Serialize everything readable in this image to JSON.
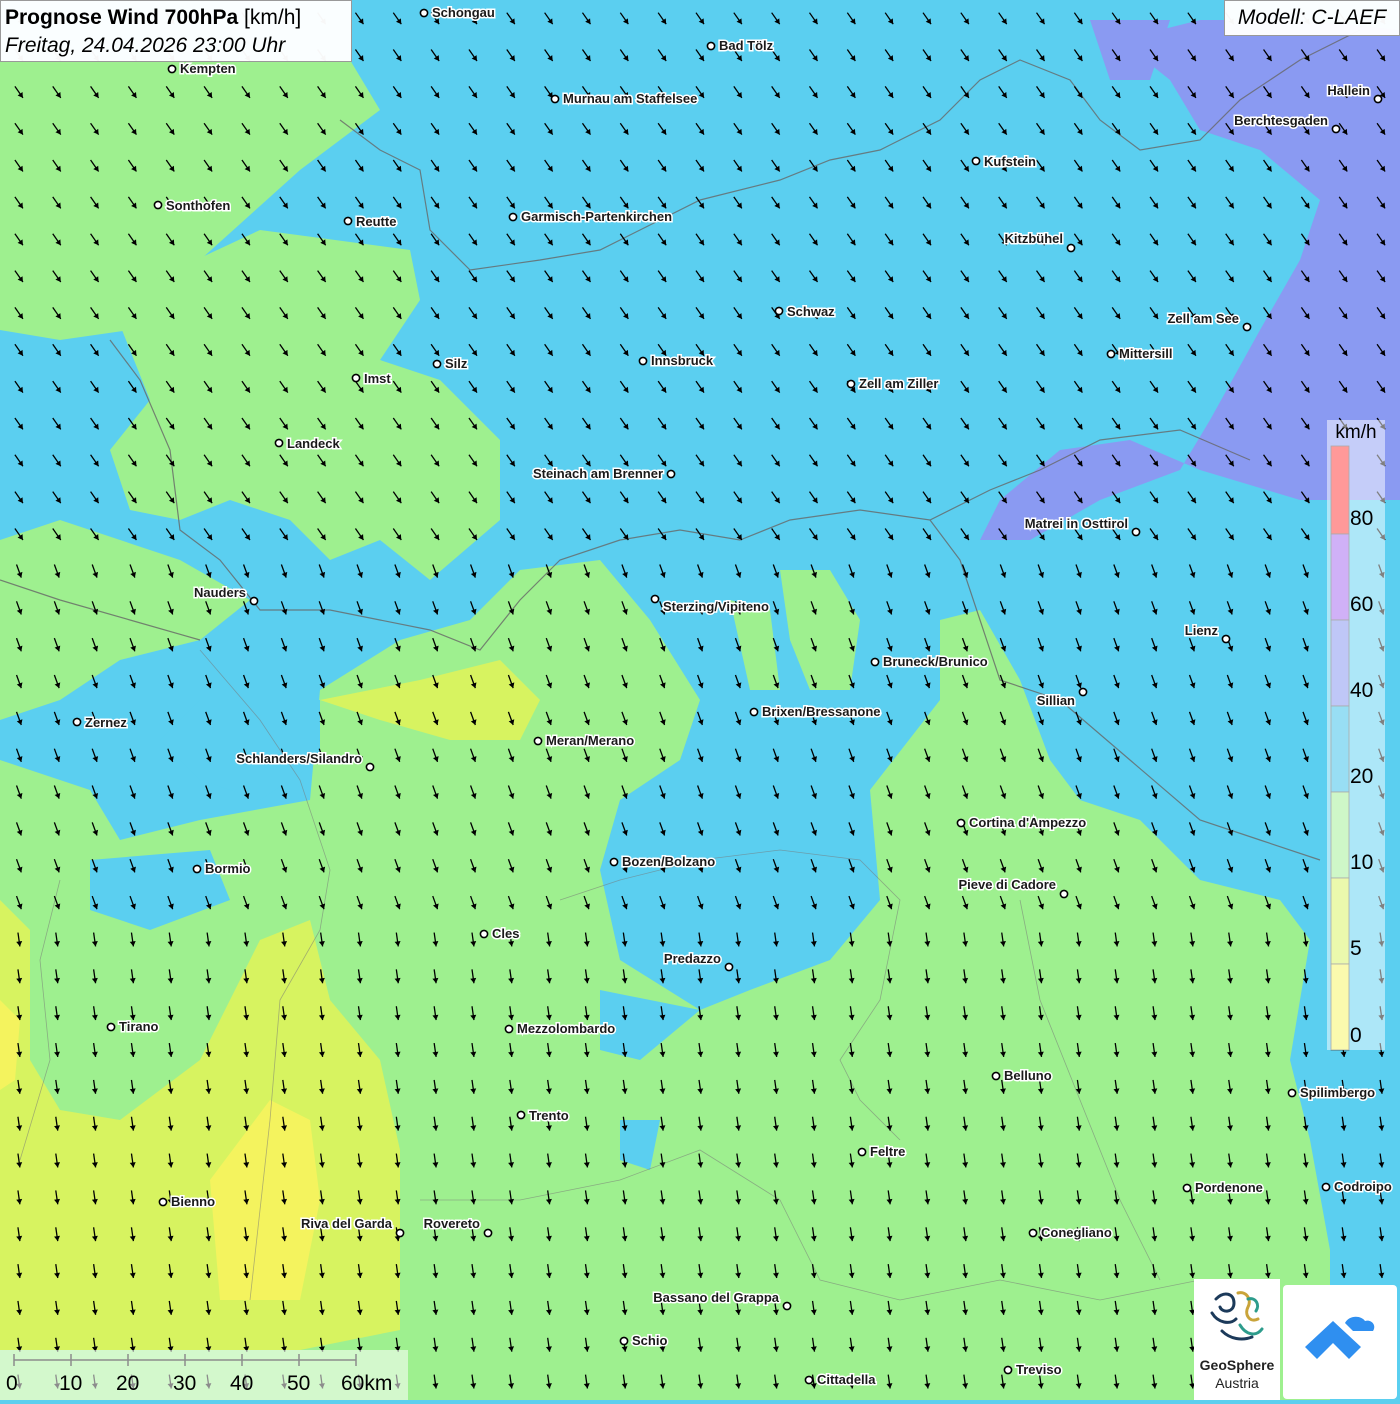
{
  "header": {
    "title_bold": "Prognose Wind 700hPa",
    "title_unit": "[km/h]",
    "subtitle": "Freitag, 24.04.2026 23:00 Uhr",
    "model": "Modell: C-LAEF"
  },
  "legend": {
    "unit": "km/h",
    "ticks": [
      "80",
      "60",
      "40",
      "20",
      "10",
      "5",
      "0"
    ],
    "colors": {
      "above_80": "#ff3333",
      "60_80": "#a062ee",
      "40_60": "#7f8fef",
      "20_40": "#5bc6ee",
      "10_20": "#2bbce8",
      "5_10": "#9cef90",
      "0_5": "#d6f25a",
      "zero": "#f6f55c"
    }
  },
  "scale": {
    "labels": [
      "0",
      "10",
      "20",
      "30",
      "40",
      "50",
      "60km"
    ]
  },
  "cities": [
    {
      "name": "Schongau"
    },
    {
      "name": "Bad Tölz"
    },
    {
      "name": "Kempten"
    },
    {
      "name": "Murnau am Staffelsee"
    },
    {
      "name": "Hallein"
    },
    {
      "name": "Berchtesgaden"
    },
    {
      "name": "Kufstein"
    },
    {
      "name": "Sonthofen"
    },
    {
      "name": "Reutte"
    },
    {
      "name": "Garmisch-Partenkirchen"
    },
    {
      "name": "Kitzbühel"
    },
    {
      "name": "Schwaz"
    },
    {
      "name": "Zell am See"
    },
    {
      "name": "Mittersill"
    },
    {
      "name": "Innsbruck"
    },
    {
      "name": "Silz"
    },
    {
      "name": "Imst"
    },
    {
      "name": "Zell am Ziller"
    },
    {
      "name": "Landeck"
    },
    {
      "name": "Steinach am Brenner"
    },
    {
      "name": "Matrei in Osttirol"
    },
    {
      "name": "Nauders"
    },
    {
      "name": "Sterzing/Vipiteno"
    },
    {
      "name": "Lienz"
    },
    {
      "name": "Bruneck/Brunico"
    },
    {
      "name": "Sillian"
    },
    {
      "name": "Brixen/Bressanone"
    },
    {
      "name": "Zernez"
    },
    {
      "name": "Meran/Merano"
    },
    {
      "name": "Schlanders/Silandro"
    },
    {
      "name": "Cortina d'Ampezzo"
    },
    {
      "name": "Bozen/Bolzano"
    },
    {
      "name": "Bormio"
    },
    {
      "name": "Pieve di Cadore"
    },
    {
      "name": "Cles"
    },
    {
      "name": "Predazzo"
    },
    {
      "name": "Tirano"
    },
    {
      "name": "Mezzolombardo"
    },
    {
      "name": "Belluno"
    },
    {
      "name": "Spilimbergo"
    },
    {
      "name": "Trento"
    },
    {
      "name": "Feltre"
    },
    {
      "name": "Pordenone"
    },
    {
      "name": "Codroipo"
    },
    {
      "name": "Bienno"
    },
    {
      "name": "Riva del Garda"
    },
    {
      "name": "Rovereto"
    },
    {
      "name": "Conegliano"
    },
    {
      "name": "Bassano del Grappa"
    },
    {
      "name": "Schio"
    },
    {
      "name": "Treviso"
    },
    {
      "name": "Cittadella"
    }
  ],
  "wind": {
    "direction": "north-northwest",
    "arrow_rows": 38,
    "arrow_cols": 37
  },
  "logos": {
    "geosphere_name": "GeoSphere",
    "geosphere_sub": "Austria"
  }
}
